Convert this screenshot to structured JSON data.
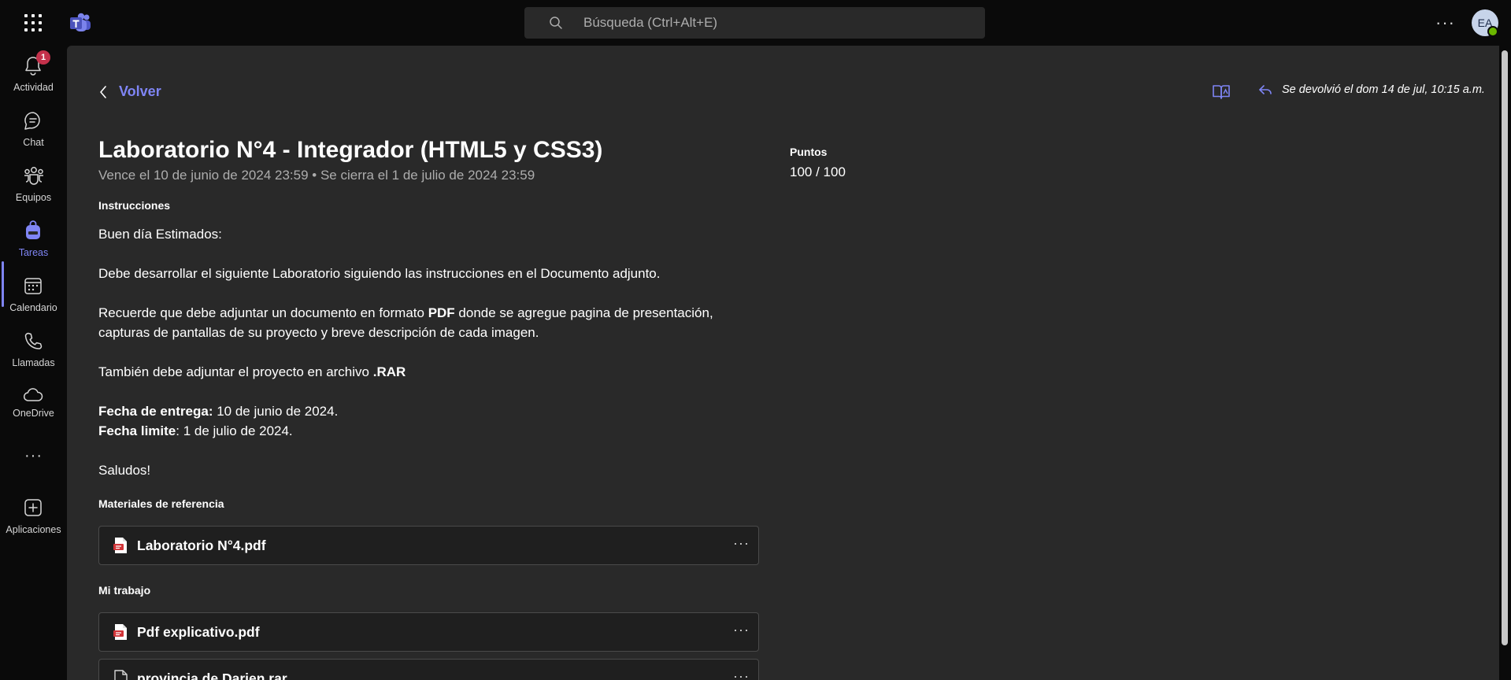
{
  "topbar": {
    "search_placeholder": "Búsqueda (Ctrl+Alt+E)",
    "more_label": "···",
    "avatar_initials": "EA"
  },
  "rail": {
    "items": [
      {
        "label": "Actividad",
        "icon": "bell-icon"
      },
      {
        "label": "Chat",
        "icon": "chat-icon"
      },
      {
        "label": "Equipos",
        "icon": "teams-icon"
      },
      {
        "label": "Tareas",
        "icon": "backpack-icon",
        "active": true
      },
      {
        "label": "Calendario",
        "icon": "calendar-icon"
      },
      {
        "label": "Llamadas",
        "icon": "phone-icon"
      },
      {
        "label": "OneDrive",
        "icon": "cloud-icon"
      },
      {
        "label": "Aplicaciones",
        "icon": "add-app-icon"
      }
    ],
    "activity_badge": "1",
    "more_label": "···"
  },
  "header": {
    "back_label": "Volver",
    "returned_text": "Se devolvió el dom 14 de jul, 10:15 a.m."
  },
  "assignment": {
    "title": "Laboratorio N°4 - Integrador (HTML5 y CSS3)",
    "due_text": "Vence el 10 de junio de 2024 23:59 • Se cierra el 1 de julio de 2024 23:59",
    "points_label": "Puntos",
    "points_value": "100 / 100",
    "instructions_label": "Instrucciones",
    "instructions": {
      "greeting": "Buen día Estimados:",
      "line1": "Debe desarrollar el siguiente Laboratorio siguiendo las instrucciones en el Documento adjunto.",
      "line2_pre": "Recuerde que debe adjuntar un documento en formato ",
      "line2_bold": "PDF",
      "line2_post": " donde se agregue pagina de presentación,",
      "line3": "capturas de pantallas de su proyecto y breve descripción de cada imagen.",
      "line4_pre": "También debe adjuntar el proyecto en archivo ",
      "line4_bold": ".RAR",
      "due_label": "Fecha de entrega:",
      "due_value": " 10 de junio de 2024.",
      "limit_label": "Fecha limite",
      "limit_value": ": 1 de julio de 2024.",
      "closing": "Saludos!"
    },
    "reference_label": "Materiales de referencia",
    "reference_files": [
      {
        "name": "Laboratorio N°4.pdf",
        "icon": "pdf-icon"
      }
    ],
    "my_work_label": "Mi trabajo",
    "my_work_files": [
      {
        "name": "Pdf explicativo.pdf",
        "icon": "pdf-icon"
      },
      {
        "name": "provincia de Darien.rar",
        "icon": "file-icon"
      }
    ],
    "file_more_label": "···"
  },
  "colors": {
    "accent": "#7f85f5",
    "background": "#292929",
    "rail": "#0a0a0a",
    "pdf_red": "#d13438"
  }
}
